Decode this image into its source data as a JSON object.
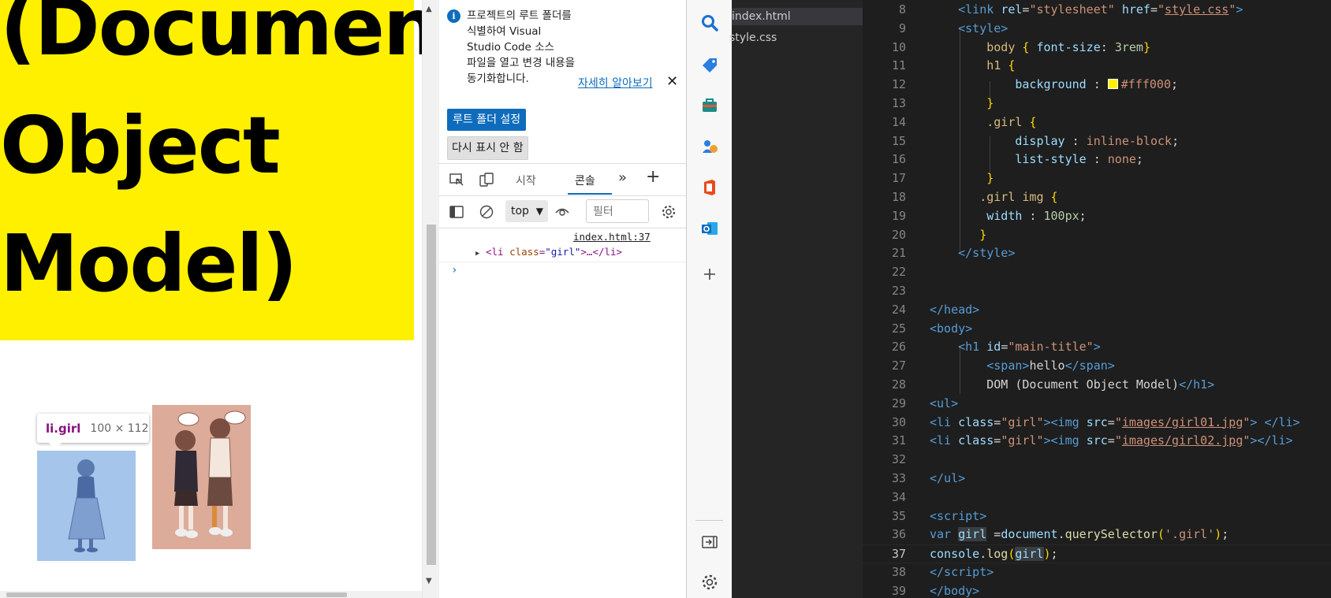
{
  "page": {
    "h1_text": "(Document\nObject\nModel)",
    "tooltip_tag": "li.girl",
    "tooltip_dim": "100 × 112",
    "highlight_color": "#fff000"
  },
  "devtools": {
    "info_message": "프로젝트의 루트 폴더를 식별하여 Visual Studio Code 소스 파일을 열고 변경 내용을 동기화합니다.",
    "learn_more": "자세히 알아보기",
    "set_root_button": "루트 폴더 설정",
    "dont_show_button": "다시 표시 안 함",
    "tabs": {
      "welcome": "시작",
      "console": "콘솔"
    },
    "context": "top",
    "filter_placeholder": "필터",
    "log": {
      "source": "index.html:37",
      "tag_open": "<li",
      "attr_name": "class",
      "attr_value": "\"girl\"",
      "tag_rest": ">…</li>"
    },
    "prompt": "›"
  },
  "explorer": {
    "files": [
      {
        "name": "index.html",
        "active": true
      },
      {
        "name": "style.css",
        "active": false
      }
    ]
  },
  "editor": {
    "current_line": 37,
    "lines": [
      {
        "n": "8",
        "html": "    <span class=\"c-tag\">&lt;link</span> <span class=\"c-att\">rel</span>=<span class=\"c-str\">\"stylesheet\"</span> <span class=\"c-att\">href</span>=<span class=\"c-str\">\"<span class=\"c-url\">style.css</span>\"</span><span class=\"c-tag\">&gt;</span>"
      },
      {
        "n": "9",
        "html": "    <span class=\"c-tag\">&lt;style&gt;</span>"
      },
      {
        "n": "10",
        "html": "        <span class=\"c-sel\">body</span> <span class=\"c-br\">{</span> <span class=\"c-prop\">font-size</span>: <span class=\"c-num\">3rem</span><span class=\"c-br\">}</span>"
      },
      {
        "n": "11",
        "html": "        <span class=\"c-sel\">h1</span> <span class=\"c-br\">{</span>"
      },
      {
        "n": "12",
        "html": "            <span class=\"c-prop\">background</span> : <span class=\"swatch\"></span><span class=\"c-val\">#fff000</span>;"
      },
      {
        "n": "13",
        "html": "        <span class=\"c-br\">}</span>"
      },
      {
        "n": "14",
        "html": "        <span class=\"c-sel\">.girl</span> <span class=\"c-br\">{</span>"
      },
      {
        "n": "15",
        "html": "            <span class=\"c-prop\">display</span> : <span class=\"c-val\">inline-block</span>;"
      },
      {
        "n": "16",
        "html": "            <span class=\"c-prop\">list-style</span> : <span class=\"c-val\">none</span>;"
      },
      {
        "n": "17",
        "html": "        <span class=\"c-br\">}</span>"
      },
      {
        "n": "18",
        "html": "       <span class=\"c-sel\">.girl img</span> <span class=\"c-br\">{</span>"
      },
      {
        "n": "19",
        "html": "        <span class=\"c-prop\">width</span> : <span class=\"c-num\">100px</span>;"
      },
      {
        "n": "20",
        "html": "       <span class=\"c-br\">}</span>"
      },
      {
        "n": "21",
        "html": "    <span class=\"c-tag\">&lt;/style&gt;</span>"
      },
      {
        "n": "22",
        "html": ""
      },
      {
        "n": "23",
        "html": ""
      },
      {
        "n": "24",
        "html": "<span class=\"c-tag\">&lt;/head&gt;</span>"
      },
      {
        "n": "25",
        "html": "<span class=\"c-tag\">&lt;body&gt;</span>"
      },
      {
        "n": "26",
        "html": "    <span class=\"c-tag\">&lt;h1</span> <span class=\"c-att\">id</span>=<span class=\"c-str\">\"main-title\"</span><span class=\"c-tag\">&gt;</span>"
      },
      {
        "n": "27",
        "html": "        <span class=\"c-tag\">&lt;span&gt;</span>hello<span class=\"c-tag\">&lt;/span&gt;</span>"
      },
      {
        "n": "28",
        "html": "        DOM (Document Object Model)<span class=\"c-tag\">&lt;/h1&gt;</span>"
      },
      {
        "n": "29",
        "html": "<span class=\"c-tag\">&lt;ul&gt;</span>"
      },
      {
        "n": "30",
        "html": "<span class=\"c-tag\">&lt;li</span> <span class=\"c-att\">class</span>=<span class=\"c-str\">\"girl\"</span><span class=\"c-tag\">&gt;&lt;img</span> <span class=\"c-att\">src</span>=<span class=\"c-str\">\"<span class=\"c-url\">images/girl01.jpg</span>\"</span><span class=\"c-tag\">&gt;</span> <span class=\"c-tag\">&lt;/li&gt;</span>"
      },
      {
        "n": "31",
        "html": "<span class=\"c-tag\">&lt;li</span> <span class=\"c-att\">class</span>=<span class=\"c-str\">\"girl\"</span><span class=\"c-tag\">&gt;&lt;img</span> <span class=\"c-att\">src</span>=<span class=\"c-str\">\"<span class=\"c-url\">images/girl02.jpg</span>\"</span><span class=\"c-tag\">&gt;&lt;/li&gt;</span>"
      },
      {
        "n": "32",
        "html": ""
      },
      {
        "n": "33",
        "html": "<span class=\"c-tag\">&lt;/ul&gt;</span>"
      },
      {
        "n": "34",
        "html": ""
      },
      {
        "n": "35",
        "html": "<span class=\"c-tag\">&lt;script&gt;</span>"
      },
      {
        "n": "36",
        "html": "<span class=\"c-kw\">var</span> <span class=\"c-var hl2\">girl</span> =<span class=\"c-var\">document</span>.<span class=\"c-fn\">querySelector</span><span class=\"c-br\">(</span><span class=\"c-str\">'.girl'</span><span class=\"c-br\">)</span>;"
      },
      {
        "n": "37",
        "html": "<span class=\"c-var\">console</span>.<span class=\"c-fn\">log</span><span class=\"c-br\">(</span><span class=\"c-var hl2\">girl</span><span class=\"c-br\">)</span>;"
      },
      {
        "n": "38",
        "html": "<span class=\"c-tag\">&lt;/script&gt;</span>"
      },
      {
        "n": "39",
        "html": "<span class=\"c-tag\">&lt;/body&gt;</span>"
      }
    ]
  }
}
